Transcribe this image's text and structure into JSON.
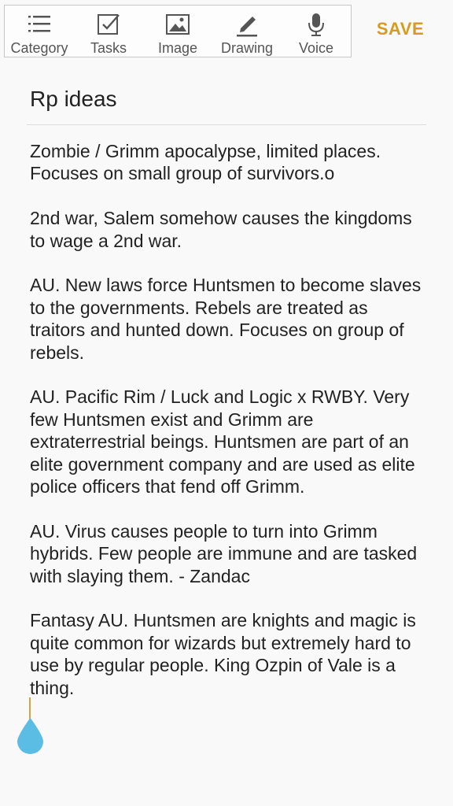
{
  "toolbar": {
    "items": [
      {
        "label": "Category",
        "icon": "list-icon"
      },
      {
        "label": "Tasks",
        "icon": "checkbox-icon"
      },
      {
        "label": "Image",
        "icon": "image-icon"
      },
      {
        "label": "Drawing",
        "icon": "pen-icon"
      },
      {
        "label": "Voice",
        "icon": "microphone-icon"
      }
    ],
    "save_label": "SAVE"
  },
  "note": {
    "title": "Rp ideas",
    "paragraphs": [
      "Zombie / Grimm apocalypse, limited places. Focuses on small group of survivors.o",
      "2nd war, Salem somehow causes the kingdoms to wage a 2nd war.",
      "AU. New laws force Huntsmen to become slaves to the governments. Rebels are treated as traitors and hunted down. Focuses on group of rebels.",
      "AU. Pacific Rim / Luck and Logic x RWBY. Very few Huntsmen exist and Grimm are extraterrestrial beings. Huntsmen are part of an elite government company and are used as elite police officers that fend off Grimm.",
      "AU. Virus causes people to turn into Grimm hybrids. Few people are immune and are tasked with slaying them. - Zandac",
      "Fantasy AU. Huntsmen are knights and magic is quite common for wizards but extremely hard to use by regular people. King Ozpin of Vale is a thing."
    ]
  },
  "colors": {
    "accent": "#d79b1e",
    "cursor_handle": "#5bbde3"
  }
}
